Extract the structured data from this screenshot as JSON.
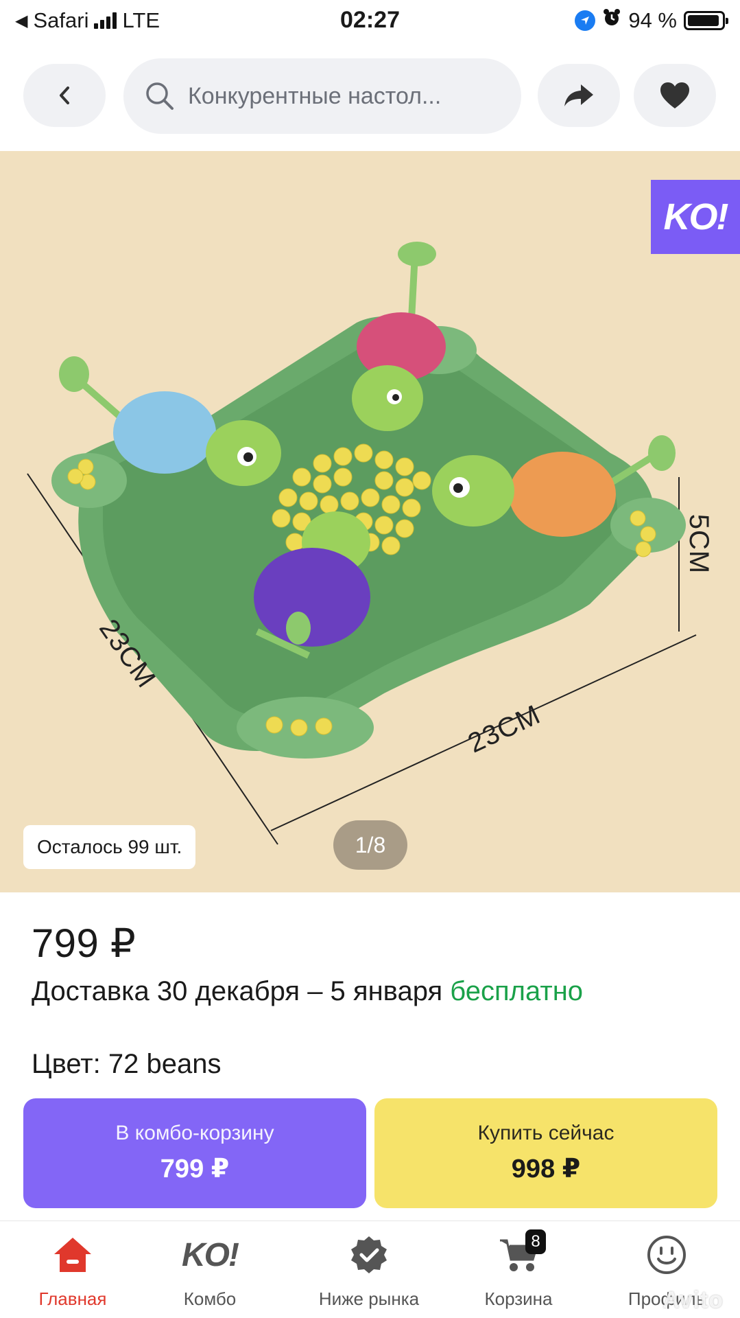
{
  "status_bar": {
    "back_app": "Safari",
    "network": "LTE",
    "time": "02:27",
    "battery": "94 %",
    "battery_level": 0.94
  },
  "nav": {
    "search_text": "Конкурентные настол..."
  },
  "gallery": {
    "badge": "KO!",
    "stock_text": "Осталось 99 шт.",
    "counter": "1/8",
    "dims": {
      "left": "23CM",
      "bottom": "23CM",
      "right": "5CM"
    }
  },
  "product": {
    "price": "799 ₽",
    "delivery_text": "Доставка 30 декабря – 5 января",
    "delivery_free": "бесплатно",
    "color_line": "Цвет: 72 beans"
  },
  "actions": {
    "combo_label": "В комбо-корзину",
    "combo_price": "799 ₽",
    "buy_label": "Купить сейчас",
    "buy_price": "998 ₽"
  },
  "tabbar": {
    "items": [
      {
        "label": "Главная",
        "icon": "home-icon"
      },
      {
        "label": "Комбо",
        "icon": "ko-icon"
      },
      {
        "label": "Ниже рынка",
        "icon": "badge-check-icon"
      },
      {
        "label": "Корзина",
        "icon": "cart-icon"
      },
      {
        "label": "Профиль",
        "icon": "profile-icon"
      }
    ],
    "cart_count": "8",
    "ko_text": "KO!"
  },
  "watermark": "Avito",
  "colors": {
    "accent_purple": "#8366f6",
    "buy_yellow": "#f6e36a",
    "free_green": "#1aa149",
    "active_red": "#e0382c",
    "hero_bg": "#f1e0bf"
  }
}
